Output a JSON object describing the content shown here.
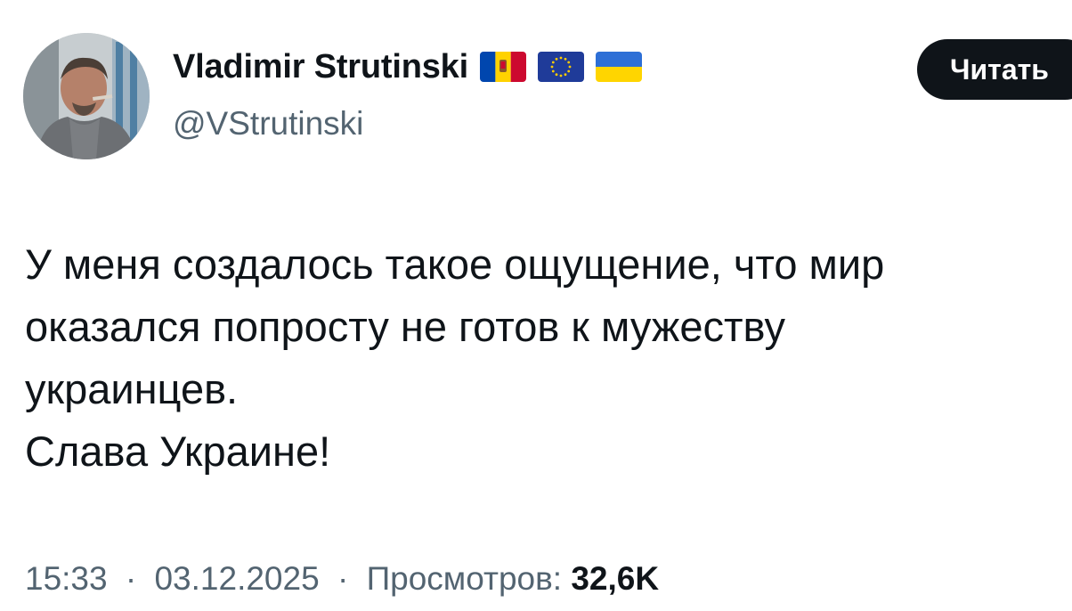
{
  "author": {
    "name": "Vladimir Strutinski",
    "handle": "@VStrutinski",
    "flags": [
      "moldova-flag-icon",
      "eu-flag-icon",
      "ukraine-flag-icon"
    ]
  },
  "follow_button": {
    "label": "Читать"
  },
  "tweet": {
    "lines": [
      "У меня создалось такое ощущение, что мир",
      "оказался попросту не готов к мужеству",
      "украинцев.",
      "Слава Украине!"
    ]
  },
  "meta": {
    "time": "15:33",
    "date": "03.12.2025",
    "separator": "·",
    "views_label": "Просмотров:",
    "views_count": "32,6K"
  },
  "colors": {
    "text": "#0f1419",
    "secondary": "#536471",
    "button_bg": "#0f1419"
  }
}
